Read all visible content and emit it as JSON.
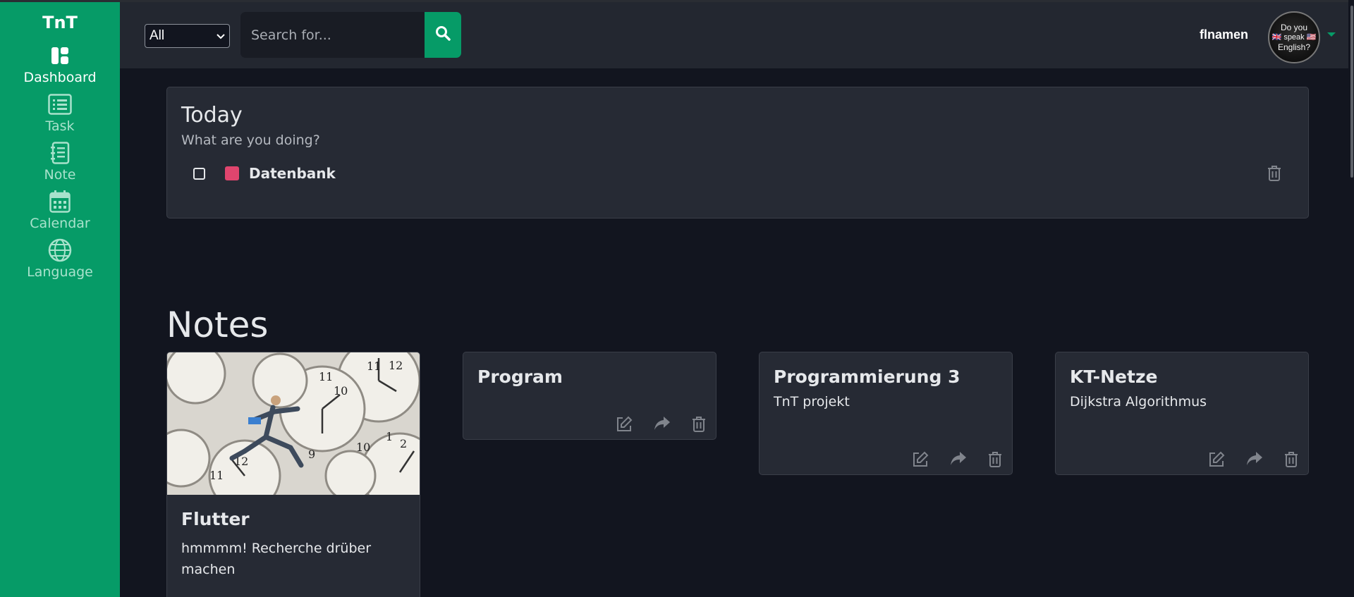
{
  "app": {
    "brand": "TnT"
  },
  "sidebar": {
    "items": [
      {
        "label": "Dashboard",
        "icon": "dashboard-icon",
        "active": true
      },
      {
        "label": "Task",
        "icon": "list-icon",
        "active": false
      },
      {
        "label": "Note",
        "icon": "notebook-icon",
        "active": false
      },
      {
        "label": "Calendar",
        "icon": "calendar-icon",
        "active": false
      },
      {
        "label": "Language",
        "icon": "globe-icon",
        "active": false
      }
    ]
  },
  "header": {
    "filter": {
      "selected": "All"
    },
    "search": {
      "placeholder": "Search for...",
      "value": ""
    },
    "user": {
      "name": "flnamen",
      "avatar_text": [
        "Do you",
        "🇬🇧 speak 🇺🇸",
        "English?"
      ]
    }
  },
  "today": {
    "title": "Today",
    "subtitle": "What are you doing?",
    "tasks": [
      {
        "name": "Datenbank",
        "color": "#e0456e",
        "done": false
      }
    ]
  },
  "notes": {
    "heading": "Notes",
    "items": [
      {
        "title": "Flutter",
        "text": "hmmmm! Recherche drüber machen",
        "has_image": true,
        "image_icon": "clock-runner-image"
      },
      {
        "title": "Program",
        "text": ""
      },
      {
        "title": "Programmierung 3",
        "text": "TnT projekt"
      },
      {
        "title": "KT-Netze",
        "text": "Dijkstra Algorithmus"
      }
    ]
  },
  "colors": {
    "accent": "#069b67",
    "background": "#12151f",
    "card": "#262a34"
  }
}
